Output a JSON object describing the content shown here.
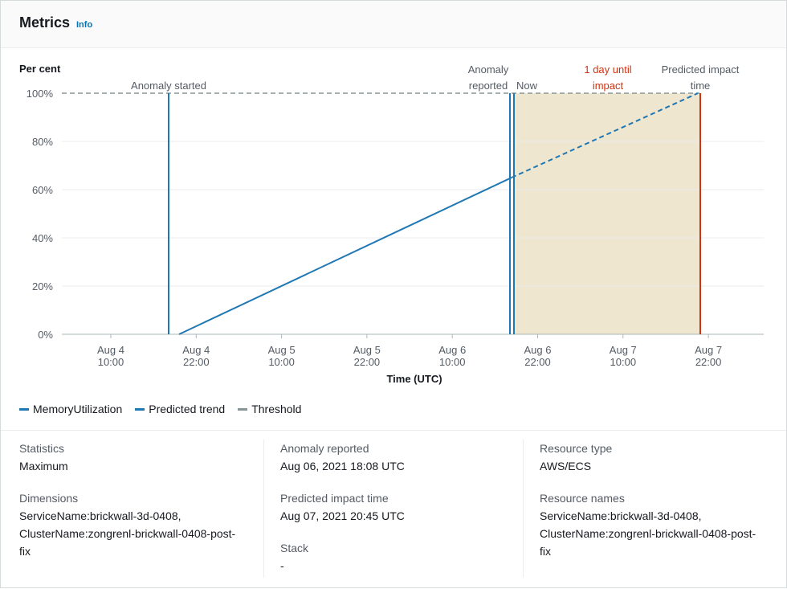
{
  "header": {
    "title": "Metrics",
    "info_label": "Info"
  },
  "chart_data": {
    "type": "line",
    "ylabel": "Per cent",
    "xlabel": "Time (UTC)",
    "ylim": [
      0,
      100
    ],
    "yticks": [
      "100%",
      "80%",
      "60%",
      "40%",
      "20%",
      "0%"
    ],
    "xticks": [
      {
        "line1": "Aug 4",
        "line2": "10:00"
      },
      {
        "line1": "Aug 4",
        "line2": "22:00"
      },
      {
        "line1": "Aug 5",
        "line2": "10:00"
      },
      {
        "line1": "Aug 5",
        "line2": "22:00"
      },
      {
        "line1": "Aug 6",
        "line2": "10:00"
      },
      {
        "line1": "Aug 6",
        "line2": "22:00"
      },
      {
        "line1": "Aug 7",
        "line2": "10:00"
      },
      {
        "line1": "Aug 7",
        "line2": "22:00"
      }
    ],
    "annotations": {
      "anomaly_started": "Anomaly started",
      "anomaly_reported_1": "Anomaly",
      "anomaly_reported_2": "reported",
      "now": "Now",
      "until_1": "1 day until",
      "until_2": "impact",
      "predicted_1": "Predicted impact",
      "predicted_2": "time"
    },
    "series": [
      {
        "name": "MemoryUtilization",
        "points": [
          [
            21.2,
            0
          ],
          [
            55.2,
            65
          ]
        ]
      },
      {
        "name": "Predicted trend",
        "points": [
          [
            55.2,
            65
          ],
          [
            77.2,
            100
          ]
        ]
      },
      {
        "name": "Threshold",
        "value": 100
      }
    ],
    "colors": {
      "line": "#1f78b4",
      "threshold": "#879596",
      "impact": "#d13212",
      "shade": "#efe6cf",
      "annotation_red": "#d13212"
    }
  },
  "legend": {
    "memory": "MemoryUtilization",
    "trend": "Predicted trend",
    "threshold": "Threshold"
  },
  "details": {
    "statistics_label": "Statistics",
    "statistics_value": "Maximum",
    "dimensions_label": "Dimensions",
    "dimensions_value_1": "ServiceName:brickwall-3d-0408,",
    "dimensions_value_2": "ClusterName:zongrenl-brickwall-0408-post-",
    "dimensions_value_3": "fix",
    "anomaly_reported_label": "Anomaly reported",
    "anomaly_reported_value": "Aug 06, 2021 18:08 UTC",
    "predicted_label": "Predicted impact time",
    "predicted_value": "Aug 07, 2021 20:45 UTC",
    "stack_label": "Stack",
    "stack_value": "-",
    "resource_type_label": "Resource type",
    "resource_type_value": "AWS/ECS",
    "resource_names_label": "Resource names",
    "resource_names_value_1": "ServiceName:brickwall-3d-0408,",
    "resource_names_value_2": "ClusterName:zongrenl-brickwall-0408-post-",
    "resource_names_value_3": "fix"
  }
}
